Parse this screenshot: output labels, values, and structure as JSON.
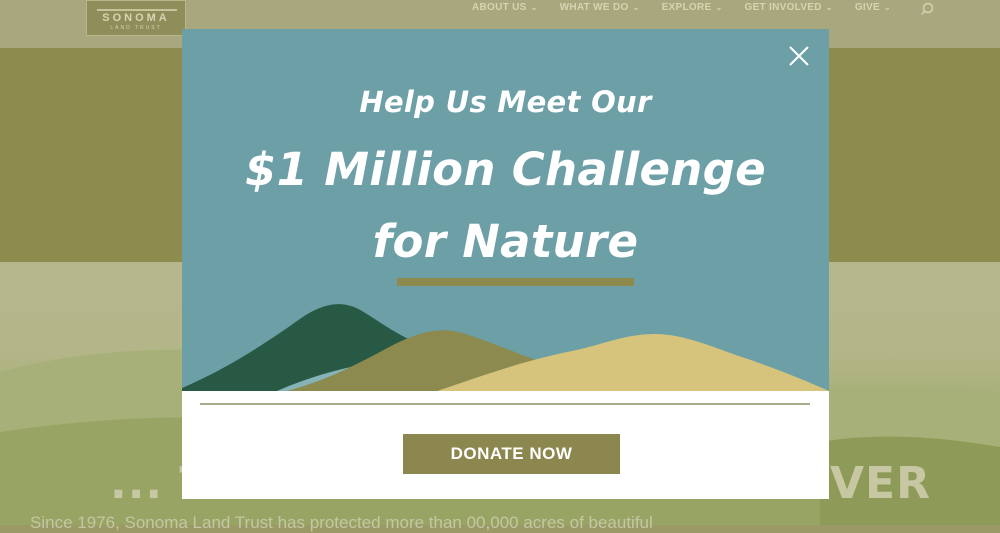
{
  "site": {
    "logo_name": "SONOMA",
    "logo_sub": "LAND TRUST",
    "nav": [
      {
        "label": "ABOUT US"
      },
      {
        "label": "WHAT WE DO"
      },
      {
        "label": "EXPLORE"
      },
      {
        "label": "GET INVOLVED"
      },
      {
        "label": "GIVE"
      }
    ],
    "hero_left": "... T",
    "hero_right": "VER",
    "hero_sub": "Since 1976, Sonoma Land Trust has protected more than 00,000 acres of beautiful"
  },
  "modal": {
    "line1": "Help Us Meet Our",
    "line2": "$1 Million Challenge",
    "line3": "for Nature",
    "button": "DONATE NOW",
    "close_icon": "close-icon"
  },
  "colors": {
    "teal": "#6c9fa6",
    "olive": "#8c874e",
    "dark_green": "#285944",
    "sand": "#d6c47c"
  }
}
